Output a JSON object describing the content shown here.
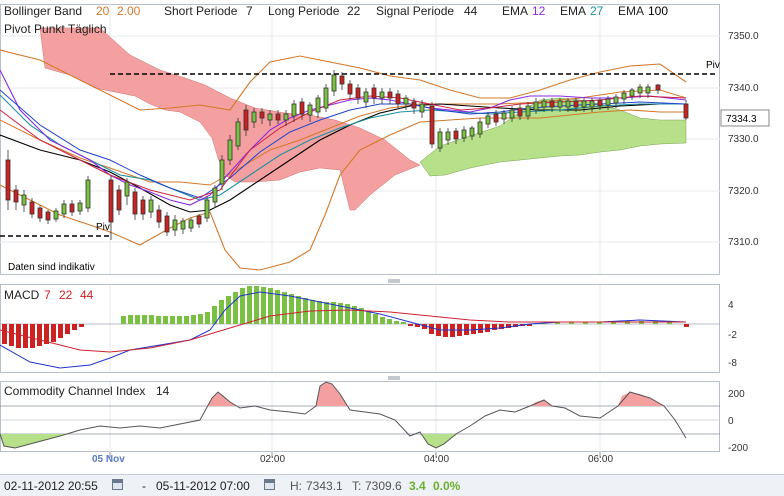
{
  "header": {
    "bollinger_label": "Bollinger Band",
    "bollinger_period": "20",
    "bollinger_dev": "2.00",
    "short_label": "Short Periode",
    "short_value": "7",
    "long_label": "Long Periode",
    "long_value": "22",
    "signal_label": "Signal Periode",
    "signal_value": "44",
    "ema1_label": "EMA",
    "ema1_value": "12",
    "ema2_label": "EMA",
    "ema2_value": "27",
    "ema3_label": "EMA",
    "ema3_value": "100",
    "pivot_label": "Pivot Punkt Täglich"
  },
  "main_chart": {
    "y_ticks": [
      "7350.0",
      "7340.0",
      "7330.0",
      "7320.0",
      "7310.0"
    ],
    "current_price": "7334.3",
    "pivot_right_label": "Piv",
    "pivot_left_label": "Piv",
    "disclaimer": "Daten sind indikativ"
  },
  "macd_panel": {
    "label": "MACD",
    "p1": "7",
    "p2": "22",
    "p3": "44",
    "y_ticks": [
      "4",
      "-2",
      "-8"
    ]
  },
  "cci_panel": {
    "label": "Commodity Channel Index",
    "period": "14",
    "y_ticks": [
      "200",
      "0",
      "-200"
    ]
  },
  "x_axis": {
    "labels": [
      "05 Nov",
      "02:00",
      "04:00",
      "06:00"
    ]
  },
  "bottom_bar": {
    "from": "02-11-2012 20:55",
    "separator": "-",
    "to": "05-11-2012 07:00",
    "high_label": "H:",
    "high_value": "7343.1",
    "low_label": "T:",
    "low_value": "7309.6",
    "change": "3.4",
    "change_pct": "0.0%"
  },
  "colors": {
    "bull": "#7ac143",
    "bear": "#cc2222",
    "cloud_red": "#f4a0a0",
    "cloud_green": "#b6e08a",
    "bollinger": "#d4782a",
    "ema12": "#8a2be2",
    "ema27": "#1e90a0",
    "ema100": "#000000"
  }
}
